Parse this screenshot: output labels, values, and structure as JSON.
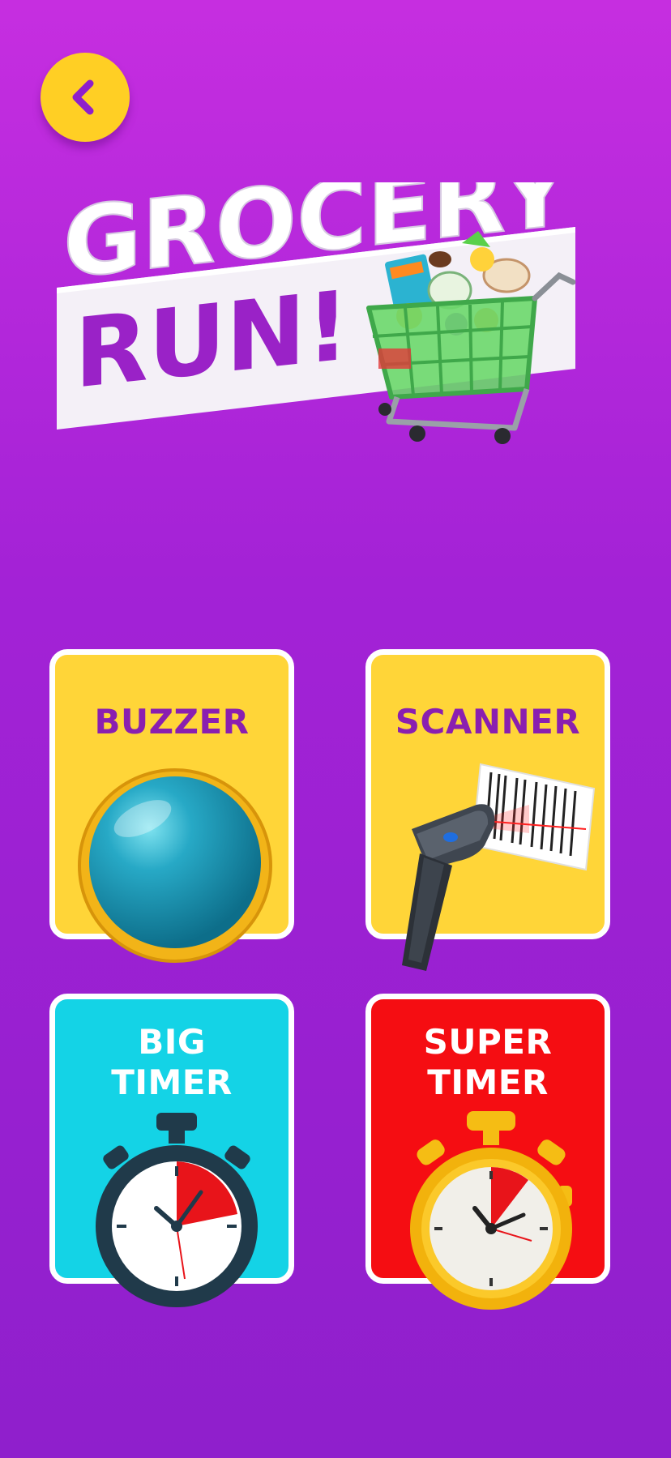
{
  "header": {
    "back_icon": "chevron-left-icon",
    "accent_color": "#ffcf24"
  },
  "logo": {
    "line1": "GROCERY",
    "line2": "RUN!",
    "image": "shopping-cart-icon"
  },
  "tiles": [
    {
      "label": "BUZZER",
      "color": "#ffd538",
      "icon": "buzzer-button-icon"
    },
    {
      "label": "SCANNER",
      "color": "#ffd538",
      "icon": "barcode-scanner-icon"
    },
    {
      "label_line1": "BIG",
      "label_line2": "TIMER",
      "color": "#14d3e6",
      "icon": "stopwatch-icon"
    },
    {
      "label_line1": "SUPER",
      "label_line2": "TIMER",
      "color": "#f50d12",
      "icon": "golden-stopwatch-icon"
    }
  ]
}
